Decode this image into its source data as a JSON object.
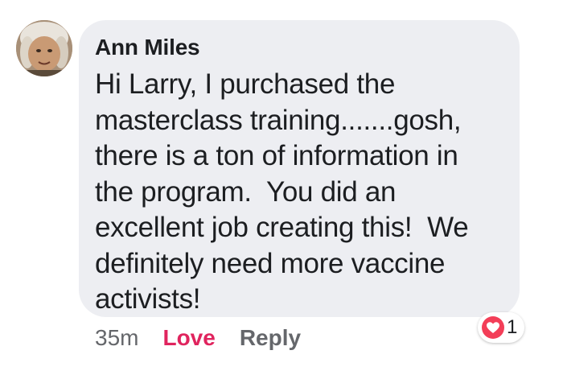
{
  "comment": {
    "author": "Ann Miles",
    "text": "Hi Larry, I purchased the\nmasterclass training.......gosh,\nthere is a ton of information in\nthe program.  You did an\nexcellent job creating this!  We\ndefinitely need more vaccine\nactivists!",
    "timestamp": "35m",
    "love_label": "Love",
    "reply_label": "Reply",
    "reaction_count": "1",
    "reaction_icon": "heart-icon",
    "avatar_icon": "user-avatar"
  },
  "colors": {
    "bubble_bg": "#edeef2",
    "love_red": "#e0245e",
    "reaction_red": "#f33e58",
    "text": "#1c1e21",
    "muted": "#65676b"
  }
}
